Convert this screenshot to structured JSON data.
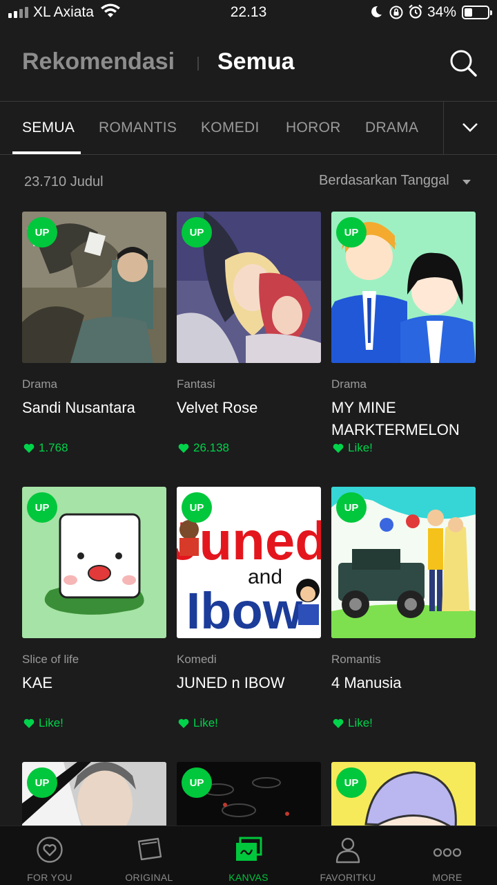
{
  "status": {
    "carrier": "XL Axiata",
    "time": "22.13",
    "battery": "34%"
  },
  "header": {
    "tab_recommend": "Rekomendasi",
    "tab_all": "Semua"
  },
  "genres": [
    {
      "label": "SEMUA",
      "active": true
    },
    {
      "label": "ROMANTIS",
      "active": false
    },
    {
      "label": "KOMEDI",
      "active": false
    },
    {
      "label": "HOROR",
      "active": false
    },
    {
      "label": "DRAMA",
      "active": false
    }
  ],
  "list": {
    "count": "23.710 Judul",
    "sort": "Berdasarkan Tanggal"
  },
  "badge": "UP",
  "cards": [
    {
      "genre": "Drama",
      "title": "Sandi Nusantara",
      "likes": "1.768"
    },
    {
      "genre": "Fantasi",
      "title": "Velvet Rose",
      "likes": "26.138"
    },
    {
      "genre": "Drama",
      "title": "MY MINE MARKTERMELON",
      "likes": "Like!"
    },
    {
      "genre": "Slice of life",
      "title": "KAE",
      "likes": "Like!"
    },
    {
      "genre": "Komedi",
      "title": "JUNED n IBOW",
      "likes": "Like!"
    },
    {
      "genre": "Romantis",
      "title": "4 Manusia",
      "likes": "Like!"
    },
    {
      "genre": "",
      "title": "",
      "likes": ""
    },
    {
      "genre": "",
      "title": "",
      "likes": ""
    },
    {
      "genre": "",
      "title": "",
      "likes": ""
    }
  ],
  "cover_text": {
    "juned_1": "Juned",
    "juned_2": "and",
    "juned_3": "Ibow"
  },
  "nav": [
    {
      "label": "FOR YOU",
      "active": false
    },
    {
      "label": "ORIGINAL",
      "active": false
    },
    {
      "label": "KANVAS",
      "active": true
    },
    {
      "label": "FAVORITKU",
      "active": false
    },
    {
      "label": "MORE",
      "active": false
    }
  ],
  "colors": {
    "accent": "#00c73c",
    "background": "#1c1c1c",
    "like": "#00d34b"
  }
}
